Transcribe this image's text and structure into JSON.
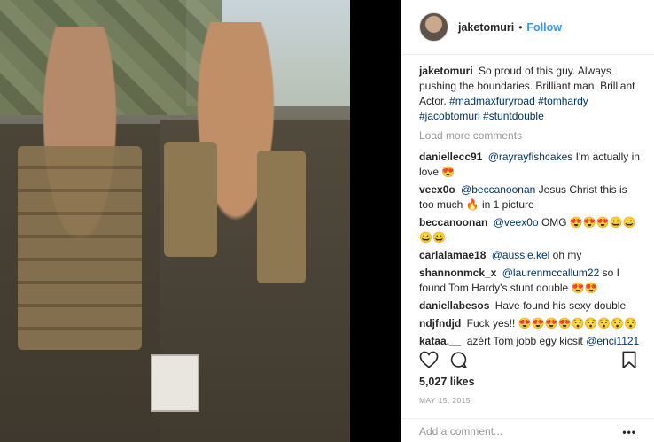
{
  "post": {
    "username": "jaketomuri",
    "follow_label": "Follow",
    "separator": "•"
  },
  "caption": {
    "user": "jaketomuri",
    "text": "So proud of this guy. Always pushing the boundaries. Brilliant man. Brilliant Actor.",
    "hashtags": "#madmaxfuryroad #tomhardy #jacobtomuri #stuntdouble"
  },
  "load_more": "Load more comments",
  "comments": [
    {
      "user": "daniellecc91",
      "mention": "@rayrayfishcakes",
      "text": "I'm actually in love 😍"
    },
    {
      "user": "veex0o",
      "mention": "@beccanoonan",
      "text": "Jesus Christ this is too much 🔥 in 1 picture"
    },
    {
      "user": "beccanoonan",
      "mention": "@veex0o",
      "text": "OMG 😍😍😍😀😀😀😀"
    },
    {
      "user": "carlalamae18",
      "mention": "@aussie.kel",
      "text": "oh my"
    },
    {
      "user": "shannonmck_x",
      "mention": "@laurenmccallum22",
      "text": "so I found Tom Hardy's stunt double 😍😍"
    },
    {
      "user": "daniellabesos",
      "mention": "",
      "text": "Have found his sexy double"
    },
    {
      "user": "ndjfndjd",
      "mention": "",
      "text": "Fuck yes!! 😍😍😍😍😯😯😯😯😯"
    },
    {
      "user": "kataa.__",
      "mention": "",
      "text": "azért Tom jobb egy kicsit",
      "mention_after": "@enci1121"
    }
  ],
  "likes": "5,027 likes",
  "date": "MAY 15, 2015",
  "add_comment_placeholder": "Add a comment...",
  "more_label": "•••",
  "icons": {
    "heart": "heart-icon",
    "comment": "comment-icon",
    "bookmark": "bookmark-icon"
  }
}
